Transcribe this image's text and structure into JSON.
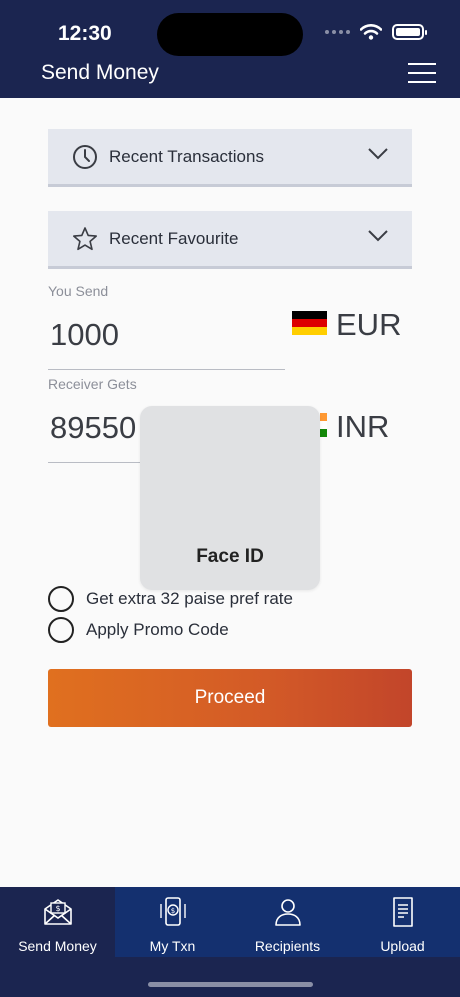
{
  "status_bar": {
    "time": "12:30"
  },
  "header": {
    "title": "Send Money"
  },
  "dropdowns": {
    "recent_transactions": "Recent Transactions",
    "recent_favourite": "Recent Favourite"
  },
  "send": {
    "label": "You Send",
    "amount": "1000",
    "currency": "EUR"
  },
  "receive": {
    "label": "Receiver Gets",
    "amount": "89550",
    "currency": "INR"
  },
  "face_id": {
    "label": "Face ID"
  },
  "options": {
    "pref_rate": "Get extra 32 paise pref rate",
    "promo": "Apply Promo Code"
  },
  "proceed_label": "Proceed",
  "tabs": [
    {
      "label": "Send Money",
      "icon": "envelope-money-icon",
      "active": true
    },
    {
      "label": "My Txn",
      "icon": "phone-dollar-icon",
      "active": false
    },
    {
      "label": "Recipients",
      "icon": "person-icon",
      "active": false
    },
    {
      "label": "Upload",
      "icon": "document-icon",
      "active": false
    }
  ],
  "colors": {
    "header_bg": "#1b2550",
    "tab_inactive_bg": "#14306f",
    "proceed_start": "#e0701f",
    "proceed_end": "#c2452a"
  }
}
